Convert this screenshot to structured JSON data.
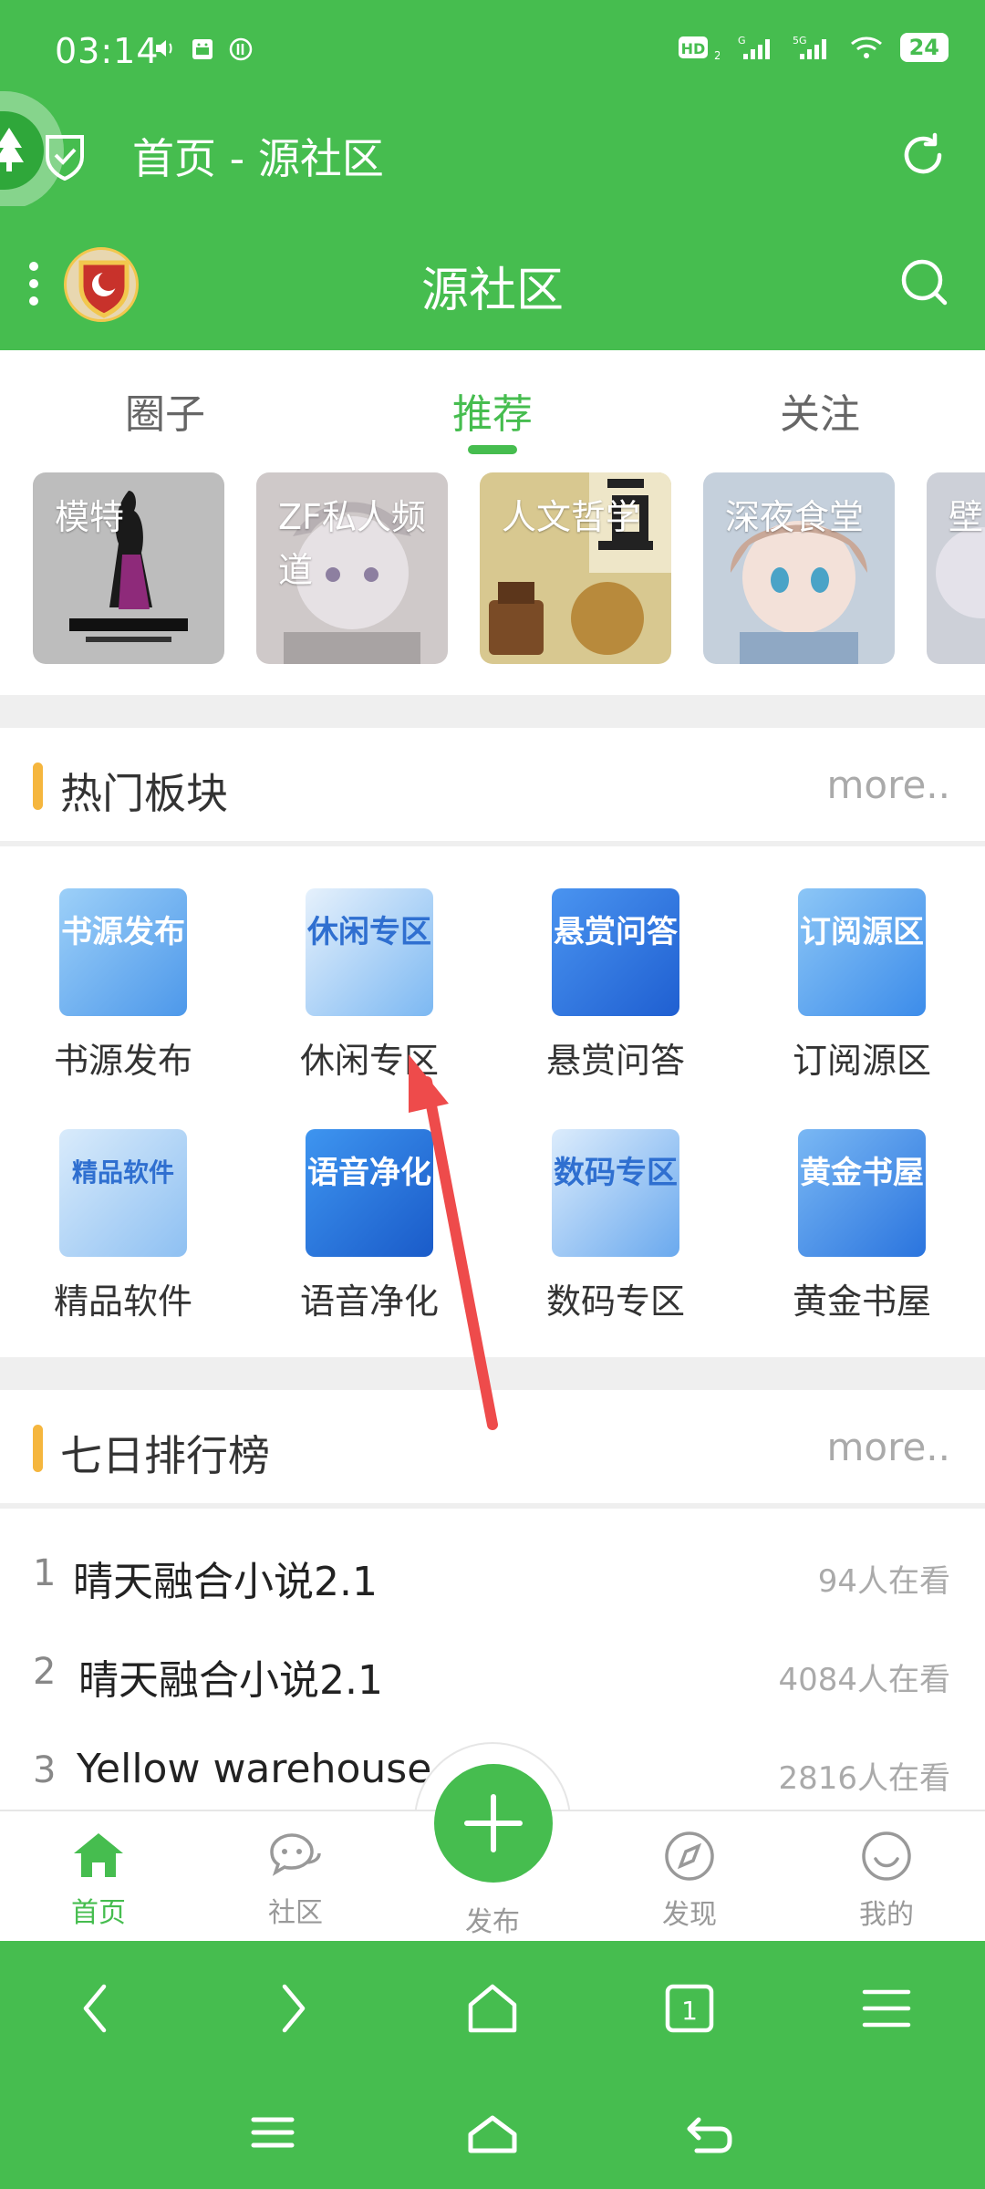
{
  "status_bar": {
    "time": "03:14",
    "battery": "24",
    "signal_labels": [
      "HD",
      "G",
      "5G"
    ]
  },
  "browser_bar": {
    "title": "首页 - 源社区"
  },
  "app_bar": {
    "title": "源社区"
  },
  "tabs": [
    {
      "label": "圈子",
      "active": false
    },
    {
      "label": "推荐",
      "active": true
    },
    {
      "label": "关注",
      "active": false
    }
  ],
  "channels": [
    {
      "label": "模特",
      "color": "#b8b8b8"
    },
    {
      "label": "ZF私人频道",
      "color": "#c9c2c2"
    },
    {
      "label": "人文哲学",
      "color": "#a8946a"
    },
    {
      "label": "深夜食堂",
      "color": "#b7c3cf"
    },
    {
      "label": "壁",
      "color": "#c8c8d2"
    }
  ],
  "hot_section": {
    "title": "热门板块",
    "more": "more..",
    "items": [
      {
        "label": "书源发布",
        "icon_text": "书源发布",
        "color": "#6fb2ef"
      },
      {
        "label": "休闲专区",
        "icon_text": "休闲专区",
        "color": "#5aa4ee"
      },
      {
        "label": "悬赏问答",
        "icon_text": "悬赏问答",
        "color": "#3d86ea"
      },
      {
        "label": "订阅源区",
        "icon_text": "订阅源区",
        "color": "#4da0f0"
      },
      {
        "label": "精品软件",
        "icon_text": "精品软件",
        "color": "#7fb6ef"
      },
      {
        "label": "语音净化",
        "icon_text": "语音净化",
        "color": "#2f7ee0"
      },
      {
        "label": "数码专区",
        "icon_text": "数码专区",
        "color": "#5aa0ea"
      },
      {
        "label": "黄金书屋",
        "icon_text": "黄金书屋",
        "color": "#3f8ee8"
      }
    ]
  },
  "rank_section": {
    "title": "七日排行榜",
    "more": "more..",
    "items": [
      {
        "rank": "1",
        "name": "晴天融合小说2.1",
        "views": "94人在看"
      },
      {
        "rank": "2",
        "name": "晴天融合小说2.1",
        "views": "4084人在看"
      },
      {
        "rank": "3",
        "name": "Yellow warehouse",
        "views": "2816人在看"
      }
    ]
  },
  "bottom_nav": {
    "items": [
      {
        "label": "首页",
        "icon": "home-icon",
        "active": true
      },
      {
        "label": "社区",
        "icon": "chat-icon",
        "active": false
      },
      {
        "label": "发布",
        "icon": "plus-icon",
        "active": false
      },
      {
        "label": "发现",
        "icon": "compass-icon",
        "active": false
      },
      {
        "label": "我的",
        "icon": "smile-icon",
        "active": false
      }
    ]
  },
  "browser_nav": {
    "tab_count": "1"
  },
  "colors": {
    "brand_green": "#46bd4f",
    "accent_orange": "#f5b63e",
    "annotation_red": "#ee4b4b"
  }
}
